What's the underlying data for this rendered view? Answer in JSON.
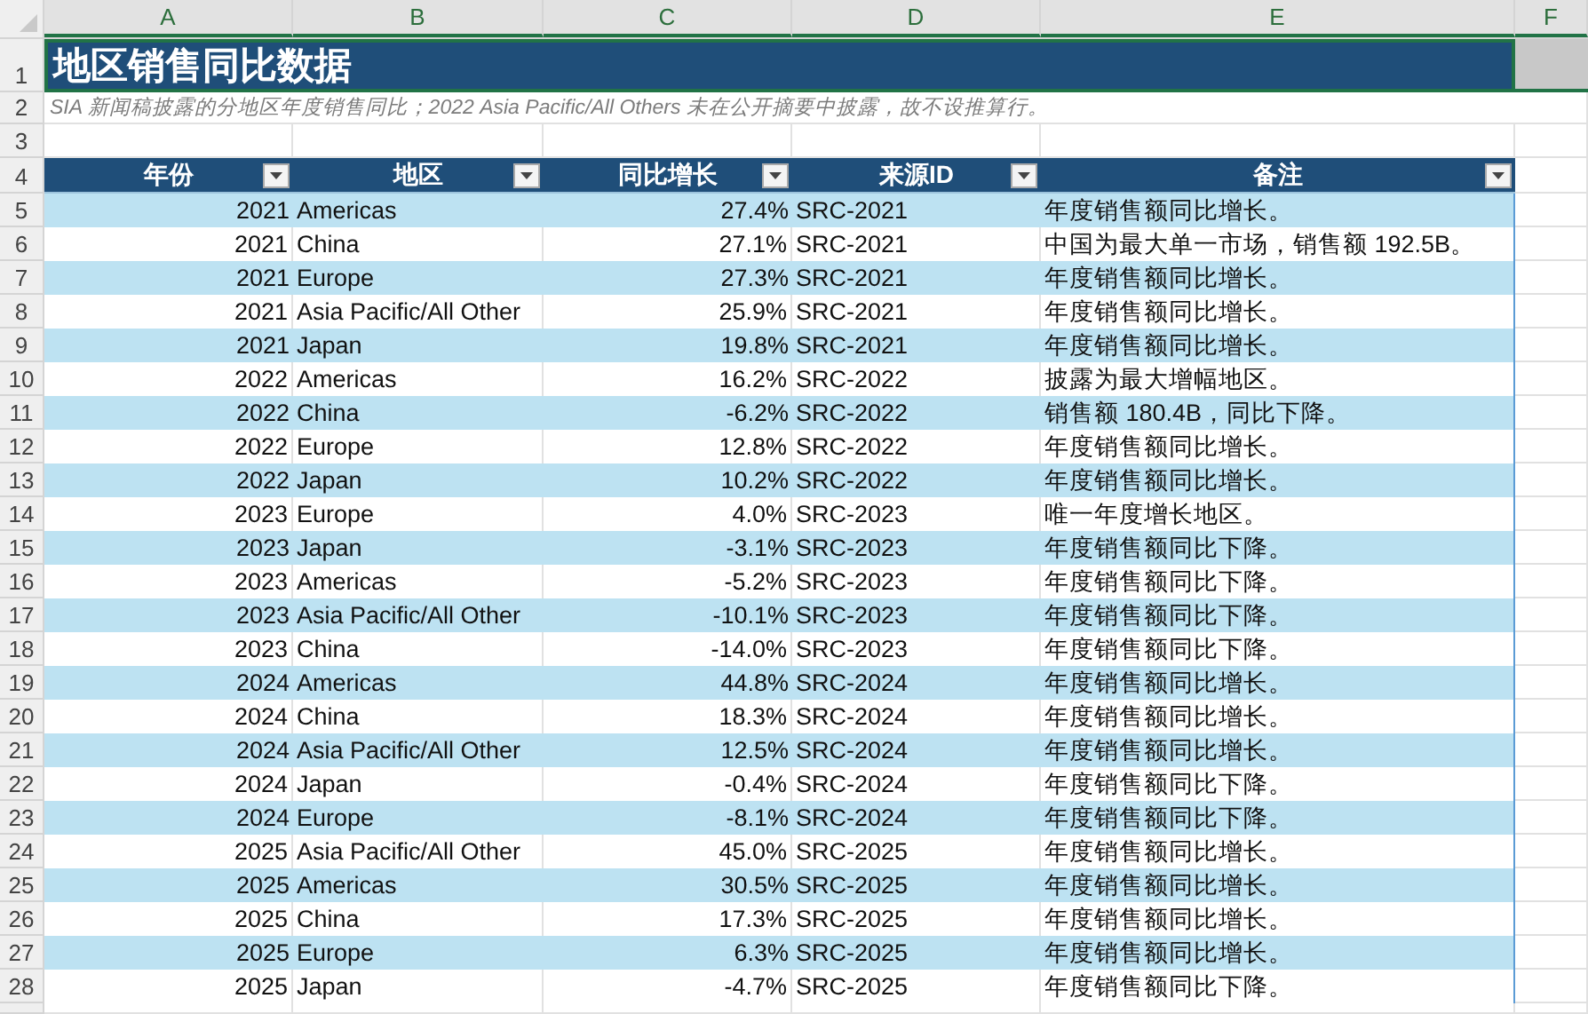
{
  "column_headers": [
    {
      "label": "A",
      "selected": true
    },
    {
      "label": "B",
      "selected": true
    },
    {
      "label": "C",
      "selected": true
    },
    {
      "label": "D",
      "selected": true
    },
    {
      "label": "E",
      "selected": true
    },
    {
      "label": "F",
      "selected": true
    }
  ],
  "title_row": {
    "row": "1",
    "text": "地区销售同比数据",
    "selected": true
  },
  "note_row": {
    "row": "2",
    "text": "SIA 新闻稿披露的分地区年度销售同比；2022 Asia Pacific/All Others 未在公开摘要中披露，故不设推算行。"
  },
  "blank_row": {
    "row": "3"
  },
  "table": {
    "row": "4",
    "columns": [
      {
        "label": "年份"
      },
      {
        "label": "地区"
      },
      {
        "label": "同比增长"
      },
      {
        "label": "来源ID"
      },
      {
        "label": "备注"
      }
    ],
    "rows": [
      {
        "row": "5",
        "year": "2021",
        "region": "Americas",
        "yoy": "27.4%",
        "source_id": "SRC-2021",
        "note": "年度销售额同比增长。"
      },
      {
        "row": "6",
        "year": "2021",
        "region": "China",
        "yoy": "27.1%",
        "source_id": "SRC-2021",
        "note": "中国为最大单一市场，销售额 192.5B。"
      },
      {
        "row": "7",
        "year": "2021",
        "region": "Europe",
        "yoy": "27.3%",
        "source_id": "SRC-2021",
        "note": "年度销售额同比增长。"
      },
      {
        "row": "8",
        "year": "2021",
        "region": "Asia Pacific/All Other",
        "yoy": "25.9%",
        "source_id": "SRC-2021",
        "note": "年度销售额同比增长。"
      },
      {
        "row": "9",
        "year": "2021",
        "region": "Japan",
        "yoy": "19.8%",
        "source_id": "SRC-2021",
        "note": "年度销售额同比增长。"
      },
      {
        "row": "10",
        "year": "2022",
        "region": "Americas",
        "yoy": "16.2%",
        "source_id": "SRC-2022",
        "note": "披露为最大增幅地区。"
      },
      {
        "row": "11",
        "year": "2022",
        "region": "China",
        "yoy": "-6.2%",
        "source_id": "SRC-2022",
        "note": "销售额 180.4B，同比下降。"
      },
      {
        "row": "12",
        "year": "2022",
        "region": "Europe",
        "yoy": "12.8%",
        "source_id": "SRC-2022",
        "note": "年度销售额同比增长。"
      },
      {
        "row": "13",
        "year": "2022",
        "region": "Japan",
        "yoy": "10.2%",
        "source_id": "SRC-2022",
        "note": "年度销售额同比增长。"
      },
      {
        "row": "14",
        "year": "2023",
        "region": "Europe",
        "yoy": "4.0%",
        "source_id": "SRC-2023",
        "note": "唯一年度增长地区。"
      },
      {
        "row": "15",
        "year": "2023",
        "region": "Japan",
        "yoy": "-3.1%",
        "source_id": "SRC-2023",
        "note": "年度销售额同比下降。"
      },
      {
        "row": "16",
        "year": "2023",
        "region": "Americas",
        "yoy": "-5.2%",
        "source_id": "SRC-2023",
        "note": "年度销售额同比下降。"
      },
      {
        "row": "17",
        "year": "2023",
        "region": "Asia Pacific/All Other",
        "yoy": "-10.1%",
        "source_id": "SRC-2023",
        "note": "年度销售额同比下降。"
      },
      {
        "row": "18",
        "year": "2023",
        "region": "China",
        "yoy": "-14.0%",
        "source_id": "SRC-2023",
        "note": "年度销售额同比下降。"
      },
      {
        "row": "19",
        "year": "2024",
        "region": "Americas",
        "yoy": "44.8%",
        "source_id": "SRC-2024",
        "note": "年度销售额同比增长。"
      },
      {
        "row": "20",
        "year": "2024",
        "region": "China",
        "yoy": "18.3%",
        "source_id": "SRC-2024",
        "note": "年度销售额同比增长。"
      },
      {
        "row": "21",
        "year": "2024",
        "region": "Asia Pacific/All Other",
        "yoy": "12.5%",
        "source_id": "SRC-2024",
        "note": "年度销售额同比增长。"
      },
      {
        "row": "22",
        "year": "2024",
        "region": "Japan",
        "yoy": "-0.4%",
        "source_id": "SRC-2024",
        "note": "年度销售额同比下降。"
      },
      {
        "row": "23",
        "year": "2024",
        "region": "Europe",
        "yoy": "-8.1%",
        "source_id": "SRC-2024",
        "note": "年度销售额同比下降。"
      },
      {
        "row": "24",
        "year": "2025",
        "region": "Asia Pacific/All Other",
        "yoy": "45.0%",
        "source_id": "SRC-2025",
        "note": "年度销售额同比增长。"
      },
      {
        "row": "25",
        "year": "2025",
        "region": "Americas",
        "yoy": "30.5%",
        "source_id": "SRC-2025",
        "note": "年度销售额同比增长。"
      },
      {
        "row": "26",
        "year": "2025",
        "region": "China",
        "yoy": "17.3%",
        "source_id": "SRC-2025",
        "note": "年度销售额同比增长。"
      },
      {
        "row": "27",
        "year": "2025",
        "region": "Europe",
        "yoy": "6.3%",
        "source_id": "SRC-2025",
        "note": "年度销售额同比增长。"
      },
      {
        "row": "28",
        "year": "2025",
        "region": "Japan",
        "yoy": "-4.7%",
        "source_id": "SRC-2025",
        "note": "年度销售额同比下降。"
      }
    ]
  }
}
